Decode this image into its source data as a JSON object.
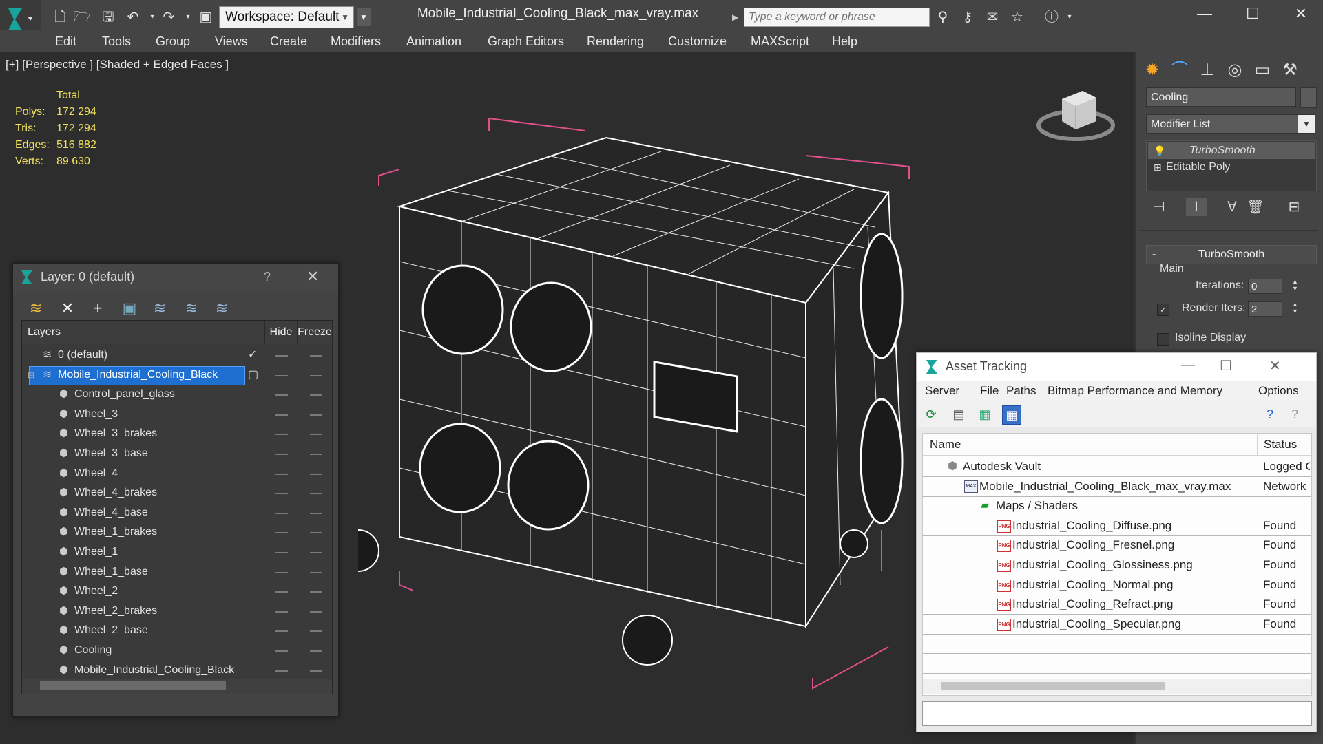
{
  "toolbar": {
    "workspace_label": "Workspace: Default",
    "document_title": "Mobile_Industrial_Cooling_Black_max_vray.max",
    "search_placeholder": "Type a keyword or phrase"
  },
  "menu": [
    "Edit",
    "Tools",
    "Group",
    "Views",
    "Create",
    "Modifiers",
    "Animation",
    "Graph Editors",
    "Rendering",
    "Customize",
    "MAXScript",
    "Help"
  ],
  "viewport": {
    "label": "[+] [Perspective ] [Shaded + Edged Faces ]",
    "stats_header": "Total",
    "stats": [
      {
        "label": "Polys:",
        "value": "172 294"
      },
      {
        "label": "Tris:",
        "value": "172 294"
      },
      {
        "label": "Edges:",
        "value": "516 882"
      },
      {
        "label": "Verts:",
        "value": "89 630"
      }
    ]
  },
  "command_panel": {
    "object_name": "Cooling",
    "modifier_list_label": "Modifier List",
    "stack": [
      "TurboSmooth",
      "Editable Poly"
    ],
    "rollout_title": "TurboSmooth",
    "group_label": "Main",
    "iterations_label": "Iterations:",
    "iterations_value": "0",
    "render_iters_label": "Render Iters:",
    "render_iters_value": "2",
    "isoline_label": "Isoline Display"
  },
  "layer_dialog": {
    "title": "Layer: 0 (default)",
    "help": "?",
    "columns": [
      "Layers",
      "Hide",
      "Freeze"
    ],
    "rows": [
      {
        "name": "0 (default)",
        "level": 0,
        "selected": false,
        "checked": true
      },
      {
        "name": "Mobile_Industrial_Cooling_Black",
        "level": 0,
        "selected": true,
        "checked": false
      },
      {
        "name": "Control_panel_glass",
        "level": 1
      },
      {
        "name": "Wheel_3",
        "level": 1
      },
      {
        "name": "Wheel_3_brakes",
        "level": 1
      },
      {
        "name": "Wheel_3_base",
        "level": 1
      },
      {
        "name": "Wheel_4",
        "level": 1
      },
      {
        "name": "Wheel_4_brakes",
        "level": 1
      },
      {
        "name": "Wheel_4_base",
        "level": 1
      },
      {
        "name": "Wheel_1_brakes",
        "level": 1
      },
      {
        "name": "Wheel_1",
        "level": 1
      },
      {
        "name": "Wheel_1_base",
        "level": 1
      },
      {
        "name": "Wheel_2",
        "level": 1
      },
      {
        "name": "Wheel_2_brakes",
        "level": 1
      },
      {
        "name": "Wheel_2_base",
        "level": 1
      },
      {
        "name": "Cooling",
        "level": 1
      },
      {
        "name": "Mobile_Industrial_Cooling_Black",
        "level": 1
      }
    ]
  },
  "asset_tracking": {
    "title": "Asset Tracking",
    "menu": [
      "Server",
      "File",
      "Paths",
      "Bitmap Performance and Memory",
      "Options"
    ],
    "columns": [
      "Name",
      "Status"
    ],
    "rows": [
      {
        "name": "Autodesk Vault",
        "status": "Logged O",
        "indent": 0,
        "icon": "vault"
      },
      {
        "name": "Mobile_Industrial_Cooling_Black_max_vray.max",
        "status": "Network",
        "indent": 1,
        "icon": "max"
      },
      {
        "name": "Maps / Shaders",
        "status": "",
        "indent": 2,
        "icon": "maps"
      },
      {
        "name": "Industrial_Cooling_Diffuse.png",
        "status": "Found",
        "indent": 3,
        "icon": "png"
      },
      {
        "name": "Industrial_Cooling_Fresnel.png",
        "status": "Found",
        "indent": 3,
        "icon": "png"
      },
      {
        "name": "Industrial_Cooling_Glossiness.png",
        "status": "Found",
        "indent": 3,
        "icon": "png"
      },
      {
        "name": "Industrial_Cooling_Normal.png",
        "status": "Found",
        "indent": 3,
        "icon": "png"
      },
      {
        "name": "Industrial_Cooling_Refract.png",
        "status": "Found",
        "indent": 3,
        "icon": "png"
      },
      {
        "name": "Industrial_Cooling_Specular.png",
        "status": "Found",
        "indent": 3,
        "icon": "png"
      }
    ]
  },
  "colors": {
    "selection_blue": "#1f6fd0",
    "stats_yellow": "#f0e060",
    "bbox_pink": "#e0508a",
    "wire_white": "#ffffff",
    "png_red": "#cc3333"
  }
}
